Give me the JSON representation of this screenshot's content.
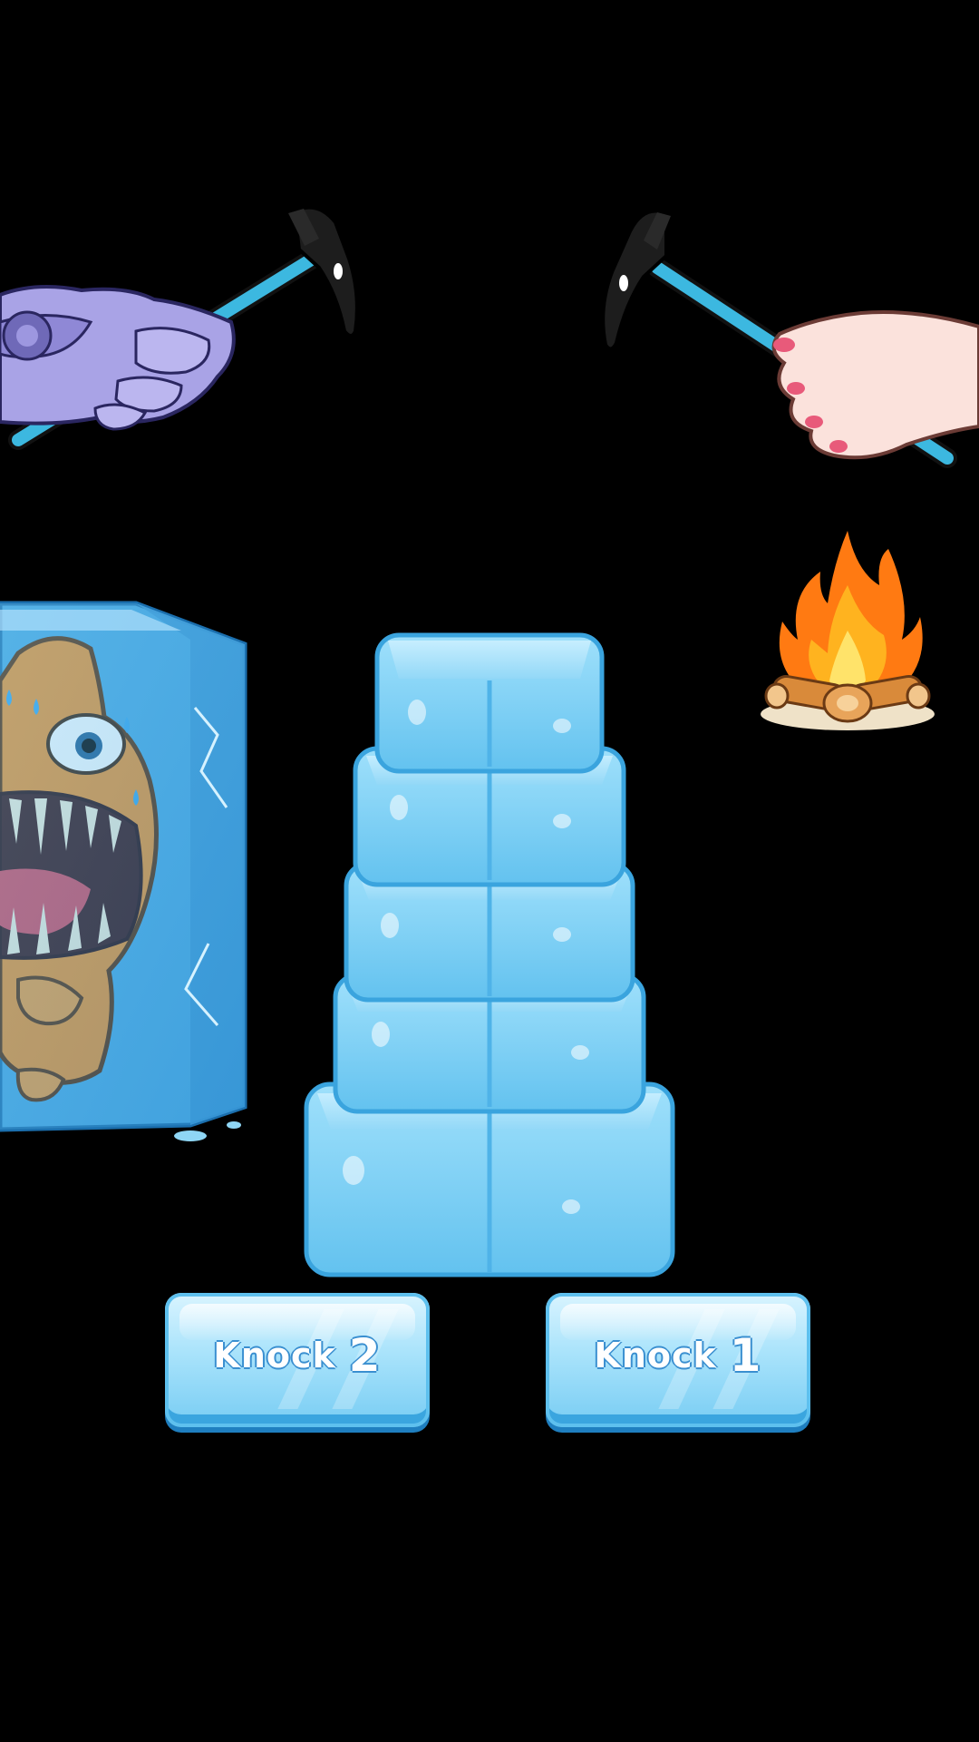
{
  "buttons": [
    {
      "label": "Knock",
      "number": "2"
    },
    {
      "label": "Knock",
      "number": "1"
    }
  ],
  "icons": {
    "left_hand": "robot-hand-holding-ice-axe-icon",
    "right_hand": "human-hand-holding-ice-axe-icon",
    "campfire": "campfire-icon",
    "frozen_character": "frozen-monster-in-ice-icon",
    "ice_tower": "stacked-ice-cubes-icon"
  },
  "colors": {
    "background": "#000000",
    "ice": "#8fd6f5",
    "ice_edge": "#4fb3e8",
    "axe_handle": "#3cb8e0",
    "robot_hand": "#a9a3e6",
    "fire": "#ff8a1c"
  }
}
